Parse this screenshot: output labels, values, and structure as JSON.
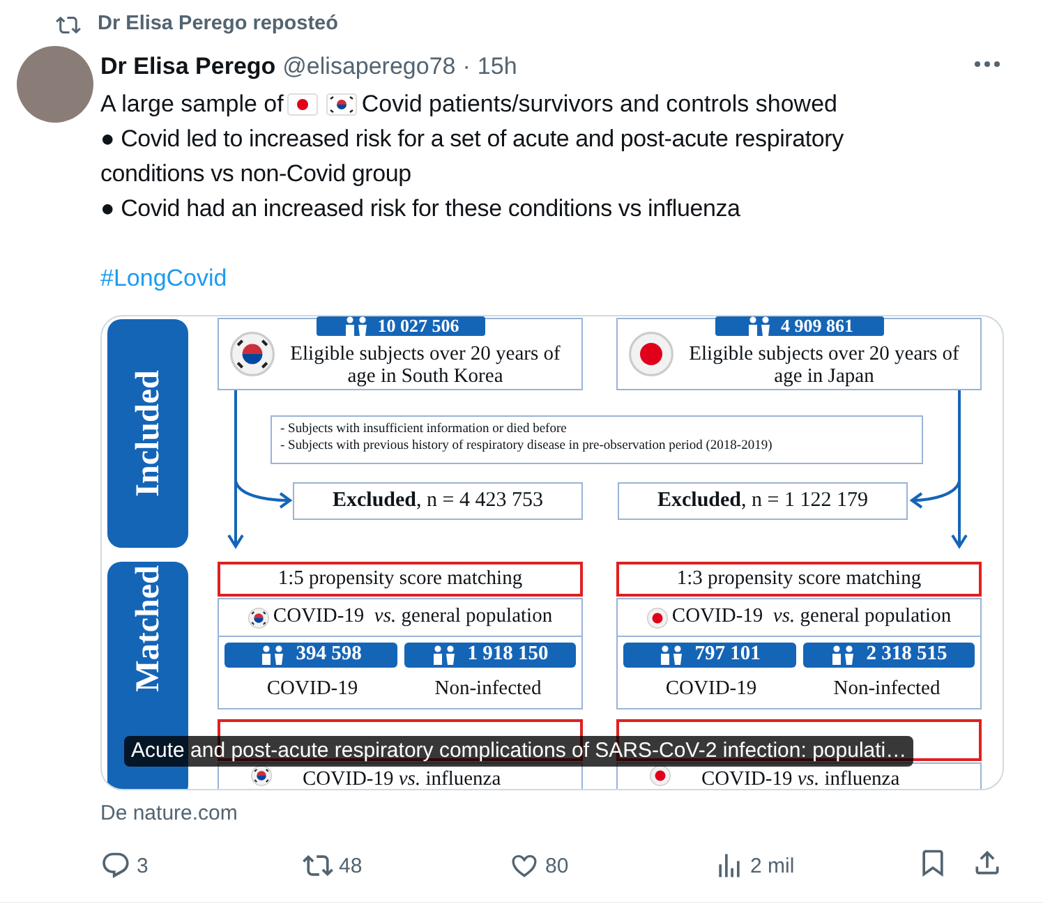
{
  "repost_banner": "Dr Elisa Perego reposteó",
  "tweet": {
    "author_name": "Dr Elisa Perego",
    "handle": "@elisaperego78",
    "separator": "·",
    "time": "15h",
    "intro_before": "A large sample of",
    "intro_after": "Covid patients/survivors and controls showed",
    "bullets": [
      "● Covid led to increased risk for a set of acute and post-acute respiratory conditions vs non-Covid group",
      "● Covid had an increased risk for these conditions vs influenza"
    ],
    "hashtag": "#LongCovid"
  },
  "link_card": {
    "figure": {
      "stages": [
        "Included",
        "Matched"
      ],
      "exclusion_criteria": [
        "- Subjects with insufficient information or died before",
        "- Subjects with previous history of respiratory disease in pre-observation period (2018-2019)"
      ],
      "countries": [
        {
          "kind": "korea",
          "count": "10 027 506",
          "eligible": "Eligible subjects over 20 years of age in South Korea",
          "excluded": "**Excluded**, n = 4 423 753",
          "matching": "1:5 propensity score matching",
          "comparison": "COVID-19  *vs.* general population",
          "covid_count": "394 598",
          "control_count": "1 918 150",
          "covid_label": "COVID-19",
          "control_label": "Non-infected",
          "comparison_2": "COVID-19 *vs.* influenza"
        },
        {
          "kind": "japan",
          "count": "4 909 861",
          "eligible": "Eligible subjects over 20 years of age in Japan",
          "excluded": "**Excluded**, n = 1 122 179",
          "matching": "1:3 propensity score matching",
          "comparison": "COVID-19  *vs.* general population",
          "covid_count": "797 101",
          "control_count": "2 318 515",
          "covid_label": "COVID-19",
          "control_label": "Non-infected",
          "comparison_2": "COVID-19 *vs.* influenza"
        }
      ]
    },
    "caption": "Acute and post-acute respiratory complications of SARS-CoV-2 infection: populati…",
    "source": "De nature.com"
  },
  "actions": [
    {
      "kind": "reply",
      "count": "3"
    },
    {
      "kind": "repost",
      "count": "48"
    },
    {
      "kind": "like",
      "count": "80"
    },
    {
      "kind": "views",
      "count": "2 mil"
    },
    {
      "kind": "bookmark"
    },
    {
      "kind": "share"
    }
  ]
}
